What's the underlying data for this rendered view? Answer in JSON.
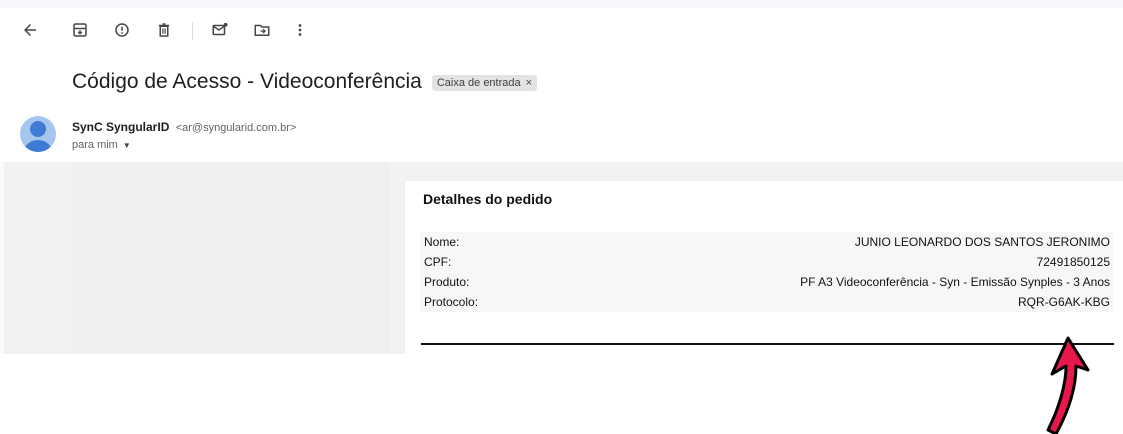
{
  "toolbar": {
    "icons": [
      "back-arrow-icon",
      "archive-icon",
      "report-spam-icon",
      "delete-icon",
      "mark-unread-icon",
      "move-to-icon",
      "more-vert-icon"
    ]
  },
  "email": {
    "subject": "Código de Acesso - Videoconferência",
    "label": "Caixa de entrada",
    "label_close": "×",
    "sender_name": "SynC SyngularID",
    "sender_email": "<ar@syngularid.com.br>",
    "recipient": "para mim"
  },
  "order": {
    "title": "Detalhes do pedido",
    "rows": [
      {
        "label": "Nome:",
        "value": "JUNIO LEONARDO DOS SANTOS JERONIMO"
      },
      {
        "label": "CPF:",
        "value": "72491850125"
      },
      {
        "label": "Produto:",
        "value": "PF A3 Videoconferência - Syn - Emissão Synples - 3 Anos"
      },
      {
        "label": "Protocolo:",
        "value": "RQR-G6AK-KBG"
      }
    ]
  },
  "colors": {
    "annotation_arrow": "#e8174c",
    "avatar": "#3f7bd4"
  }
}
